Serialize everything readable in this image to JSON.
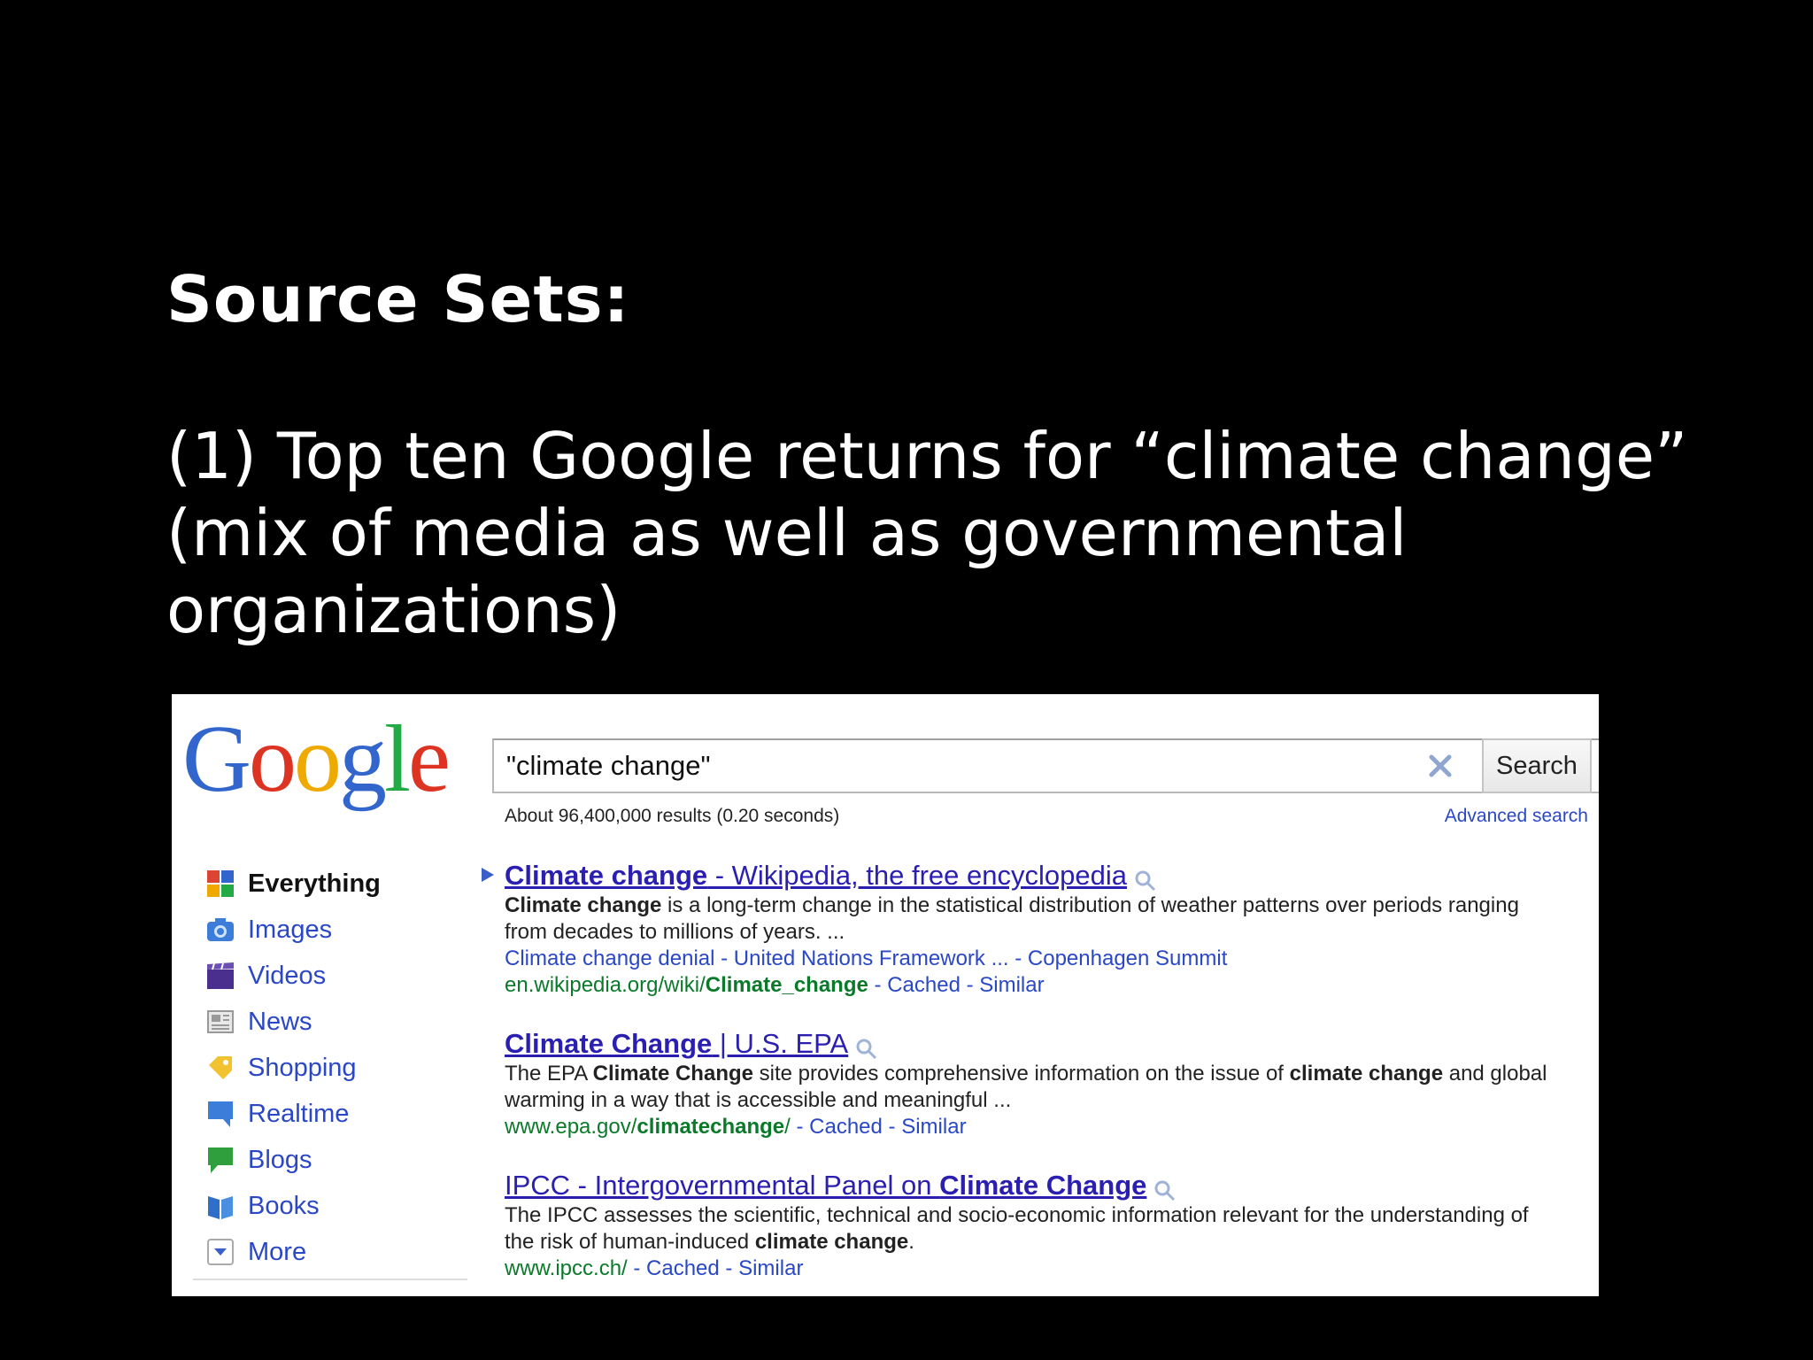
{
  "slide": {
    "heading": "Source Sets:",
    "body": "(1) Top ten Google returns for “climate change” (mix of  media as well as governmental organizations)"
  },
  "google": {
    "logo": {
      "letters": [
        "G",
        "o",
        "o",
        "g",
        "l",
        "e"
      ]
    },
    "search": {
      "query": "\"climate change\"",
      "button_label": "Search",
      "clear_icon": "close-x-icon"
    },
    "stats": "About 96,400,000 results (0.20 seconds)",
    "advanced_search": "Advanced search",
    "colors": {
      "link": "#2a1fb0",
      "nav_link": "#2a47c6",
      "url": "#0a7a2a"
    },
    "nav": {
      "items": [
        {
          "label": "Everything",
          "icon": "everything-icon"
        },
        {
          "label": "Images",
          "icon": "camera-icon"
        },
        {
          "label": "Videos",
          "icon": "film-icon"
        },
        {
          "label": "News",
          "icon": "newspaper-icon"
        },
        {
          "label": "Shopping",
          "icon": "tag-icon"
        },
        {
          "label": "Realtime",
          "icon": "speech-bubble-icon"
        },
        {
          "label": "Blogs",
          "icon": "chat-bubble-icon"
        },
        {
          "label": "Books",
          "icon": "book-icon"
        },
        {
          "label": "More",
          "icon": "dropdown-icon"
        }
      ]
    },
    "results": [
      {
        "title_bold": "Climate change",
        "title_rest": " - Wikipedia, the free encyclopedia",
        "snippet_bold": "Climate change",
        "snippet_rest": " is a long-term change in the statistical distribution of weather patterns over periods ranging from decades to millions of years. ...",
        "sublinks": "Climate change denial - United Nations Framework ... - Copenhagen Summit",
        "url_plain": "en.wikipedia.org/wiki/",
        "url_bold": "Climate_change",
        "cached": "Cached",
        "similar": "Similar"
      },
      {
        "title_bold": "Climate Change",
        "title_rest": " | U.S. EPA",
        "snippet_1": "The EPA ",
        "snippet_bold_1": "Climate Change",
        "snippet_2": " site provides comprehensive information on the issue of ",
        "snippet_bold_2": "climate change",
        "snippet_3": " and global warming in a way that is accessible and meaningful ...",
        "url_plain": "www.epa.gov/",
        "url_bold": "climatechange",
        "url_tail": "/",
        "cached": "Cached",
        "similar": "Similar"
      },
      {
        "title_plain": "IPCC - Intergovernmental Panel on ",
        "title_bold": "Climate Change",
        "snippet_1": "The IPCC assesses the scientific, technical and socio-economic information relevant for the understanding of the risk of human-induced ",
        "snippet_bold_1": "climate change",
        "snippet_2": ".",
        "url_plain": "www.ipcc.ch/",
        "cached": "Cached",
        "similar": "Similar"
      }
    ]
  }
}
